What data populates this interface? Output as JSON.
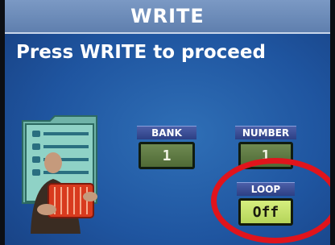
{
  "header": {
    "title": "WRITE"
  },
  "prompt": {
    "text": "Press WRITE to proceed"
  },
  "params": {
    "bank": {
      "label": "BANK",
      "value": "1"
    },
    "number": {
      "label": "NUMBER",
      "value": "1"
    },
    "loop": {
      "label": "LOOP",
      "value": "Off"
    }
  },
  "colors": {
    "screen_bg": "#1f55a0",
    "highlight_ring": "#e0141c",
    "value_active": "#c8e66a"
  },
  "icons": {
    "folder": "song-folder-accordion-icon"
  }
}
